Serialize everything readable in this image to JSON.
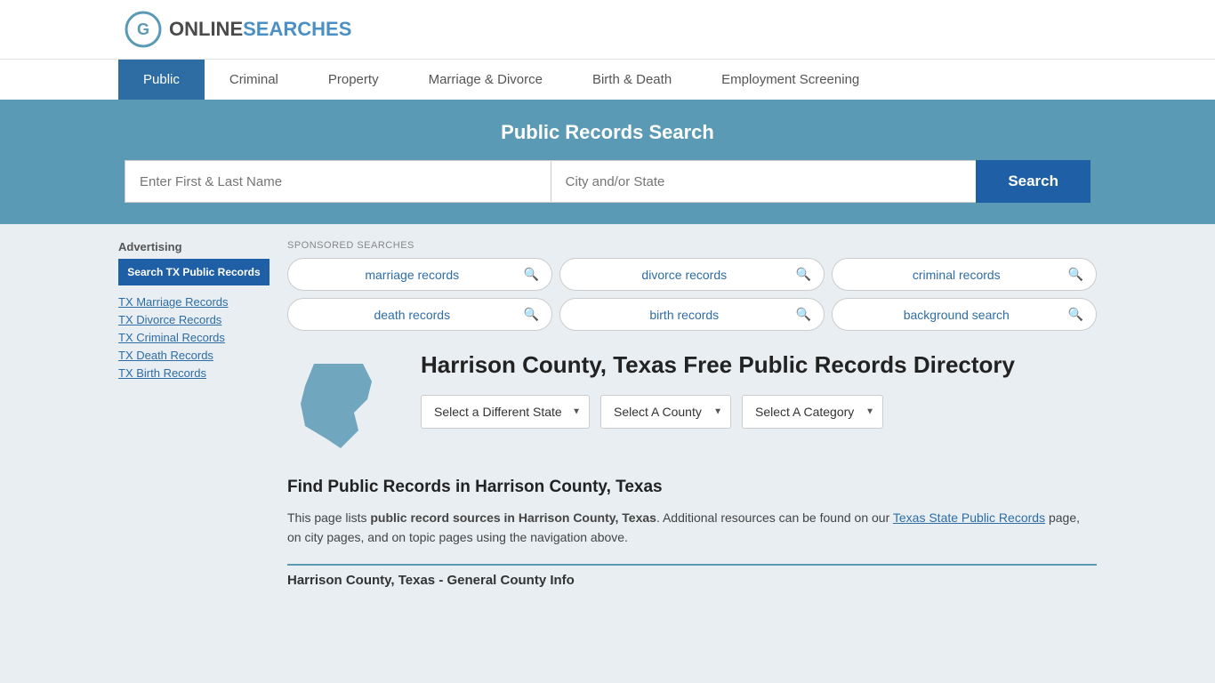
{
  "header": {
    "logo_online": "ONLINE",
    "logo_searches": "SEARCHES"
  },
  "nav": {
    "items": [
      {
        "label": "Public",
        "active": true
      },
      {
        "label": "Criminal",
        "active": false
      },
      {
        "label": "Property",
        "active": false
      },
      {
        "label": "Marriage & Divorce",
        "active": false
      },
      {
        "label": "Birth & Death",
        "active": false
      },
      {
        "label": "Employment Screening",
        "active": false
      }
    ]
  },
  "hero": {
    "title": "Public Records Search",
    "name_placeholder": "Enter First & Last Name",
    "location_placeholder": "City and/or State",
    "search_label": "Search"
  },
  "sponsored": {
    "label": "SPONSORED SEARCHES",
    "pills": [
      {
        "text": "marriage records"
      },
      {
        "text": "divorce records"
      },
      {
        "text": "criminal records"
      },
      {
        "text": "death records"
      },
      {
        "text": "birth records"
      },
      {
        "text": "background search"
      }
    ]
  },
  "location_title": "Harrison County, Texas Free Public Records Directory",
  "dropdowns": {
    "state": "Select a Different State",
    "county": "Select A County",
    "category": "Select A Category"
  },
  "find_section": {
    "title": "Find Public Records in Harrison County, Texas",
    "desc_part1": "This page lists ",
    "desc_bold": "public record sources in Harrison County, Texas",
    "desc_part2": ". Additional resources can be found on our ",
    "link_text": "Texas State Public Records",
    "desc_part3": " page, on city pages, and on topic pages using the navigation above."
  },
  "general_info": {
    "title": "Harrison County, Texas - General County Info"
  },
  "sidebar": {
    "adv_label": "Advertising",
    "ad_btn": "Search TX Public Records",
    "links": [
      {
        "text": "TX Marriage Records"
      },
      {
        "text": "TX Divorce Records"
      },
      {
        "text": "TX Criminal Records"
      },
      {
        "text": "TX Death Records"
      },
      {
        "text": "TX Birth Records"
      }
    ]
  }
}
